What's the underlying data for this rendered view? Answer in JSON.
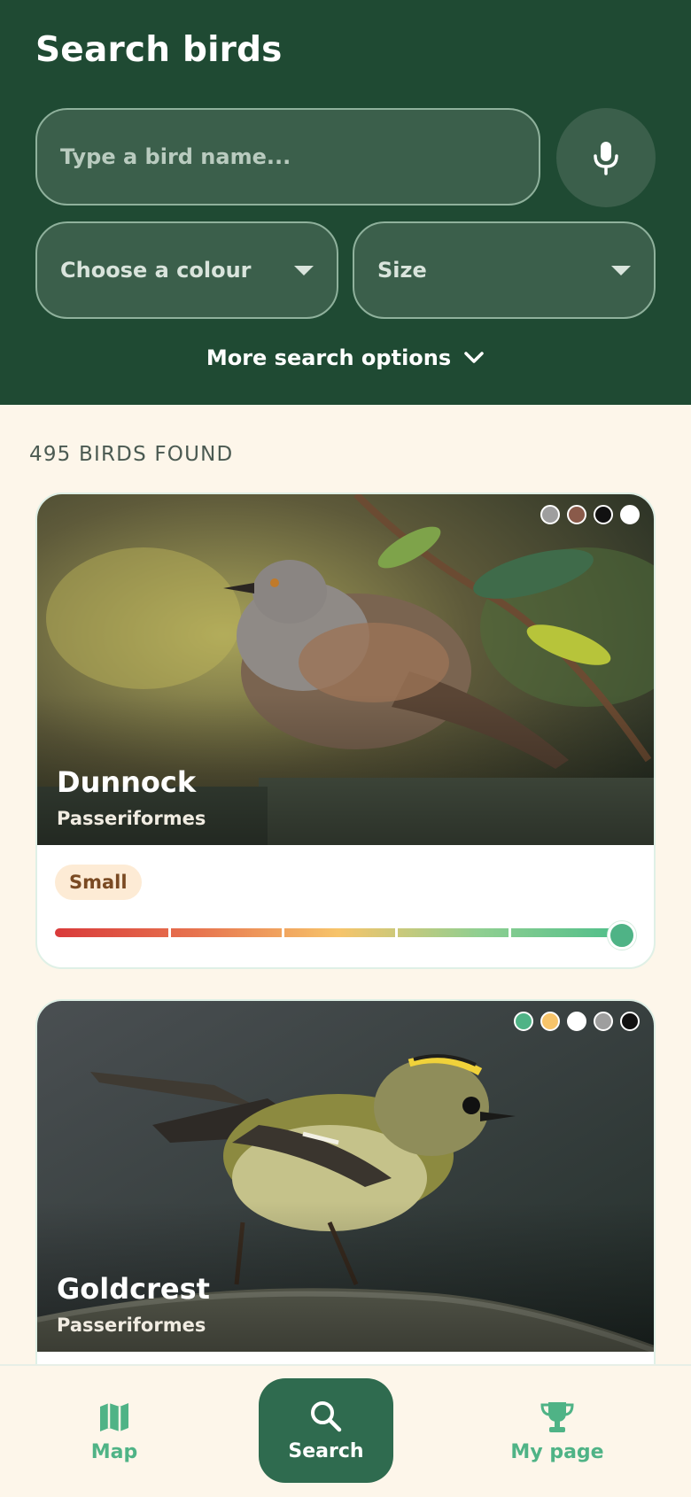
{
  "header": {
    "title": "Search birds",
    "search_placeholder": "Type a bird name...",
    "colour_select": "Choose a colour",
    "size_select": "Size",
    "more_options": "More search options"
  },
  "results": {
    "count_label": "495 BIRDS FOUND",
    "birds": [
      {
        "name": "Dunnock",
        "order": "Passeriformes",
        "size": "Small",
        "size_level": 1.0,
        "colours": [
          "#9e9e9e",
          "#8a5a4a",
          "#111111",
          "#ffffff"
        ]
      },
      {
        "name": "Goldcrest",
        "order": "Passeriformes",
        "colours": [
          "#4fb386",
          "#f7c46a",
          "#ffffff",
          "#9e9e9e",
          "#111111"
        ]
      }
    ]
  },
  "nav": {
    "map": "Map",
    "search": "Search",
    "my_page": "My page"
  },
  "colors": {
    "header_bg": "#1f4a33",
    "accent": "#4fb386",
    "page_bg": "#fdf6ea"
  }
}
